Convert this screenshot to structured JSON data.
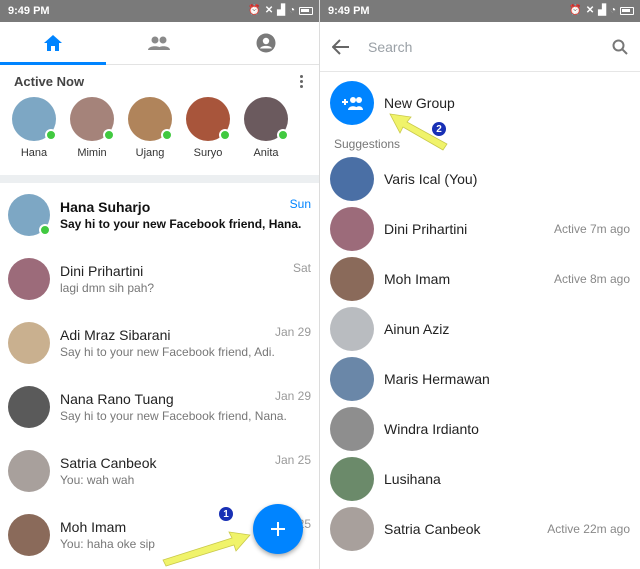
{
  "left": {
    "status_time": "9:49 PM",
    "active_title": "Active Now",
    "active_people": [
      {
        "name": "Hana",
        "color": "#7da7c4"
      },
      {
        "name": "Mimin",
        "color": "#a5837a"
      },
      {
        "name": "Ujang",
        "color": "#b0845b"
      },
      {
        "name": "Suryo",
        "color": "#a8553b"
      },
      {
        "name": "Anita",
        "color": "#6b5a5e"
      }
    ],
    "conversations": [
      {
        "name": "Hana Suharjo",
        "msg": "Say hi to your new Facebook friend, Hana.",
        "date": "Sun",
        "unread": true,
        "online": true,
        "color": "#7da7c4"
      },
      {
        "name": "Dini Prihartini",
        "msg": "lagi dmn sih pah?",
        "date": "Sat",
        "unread": false,
        "online": false,
        "color": "#9c6b7a"
      },
      {
        "name": "Adi Mraz Sibarani",
        "msg": "Say hi to your new Facebook friend, Adi.",
        "date": "Jan 29",
        "unread": false,
        "online": false,
        "color": "#c9b08f"
      },
      {
        "name": "Nana Rano Tuang",
        "msg": "Say hi to your new Facebook friend, Nana.",
        "date": "Jan 29",
        "unread": false,
        "online": false,
        "color": "#5a5a5a"
      },
      {
        "name": "Satria Canbeok",
        "msg": "You: wah wah",
        "date": "Jan 25",
        "unread": false,
        "online": false,
        "color": "#a8a09c"
      },
      {
        "name": "Moh Imam",
        "msg": "You: haha oke sip",
        "date": "Jan 25",
        "unread": false,
        "online": false,
        "color": "#8a6a5a"
      }
    ],
    "badge": "1"
  },
  "right": {
    "status_time": "9:49 PM",
    "search_placeholder": "Search",
    "new_group_label": "New Group",
    "suggestions_label": "Suggestions",
    "suggestions": [
      {
        "name": "Varis Ical (You)",
        "status": "",
        "color": "#4a6fa5"
      },
      {
        "name": "Dini Prihartini",
        "status": "Active 7m ago",
        "color": "#9c6b7a"
      },
      {
        "name": "Moh Imam",
        "status": "Active 8m ago",
        "color": "#8a6a5a"
      },
      {
        "name": "Ainun Aziz",
        "status": "",
        "color": "#b9bcc0"
      },
      {
        "name": "Maris Hermawan",
        "status": "",
        "color": "#6a87a8"
      },
      {
        "name": "Windra Irdianto",
        "status": "",
        "color": "#8e8e8e"
      },
      {
        "name": "Lusihana",
        "status": "",
        "color": "#6b8a6a"
      },
      {
        "name": "Satria Canbeok",
        "status": "Active 22m ago",
        "color": "#a8a09c"
      }
    ],
    "badge": "2"
  },
  "colors": {
    "accent": "#0084ff",
    "online": "#41c940",
    "arrow": "#f0f36a"
  }
}
